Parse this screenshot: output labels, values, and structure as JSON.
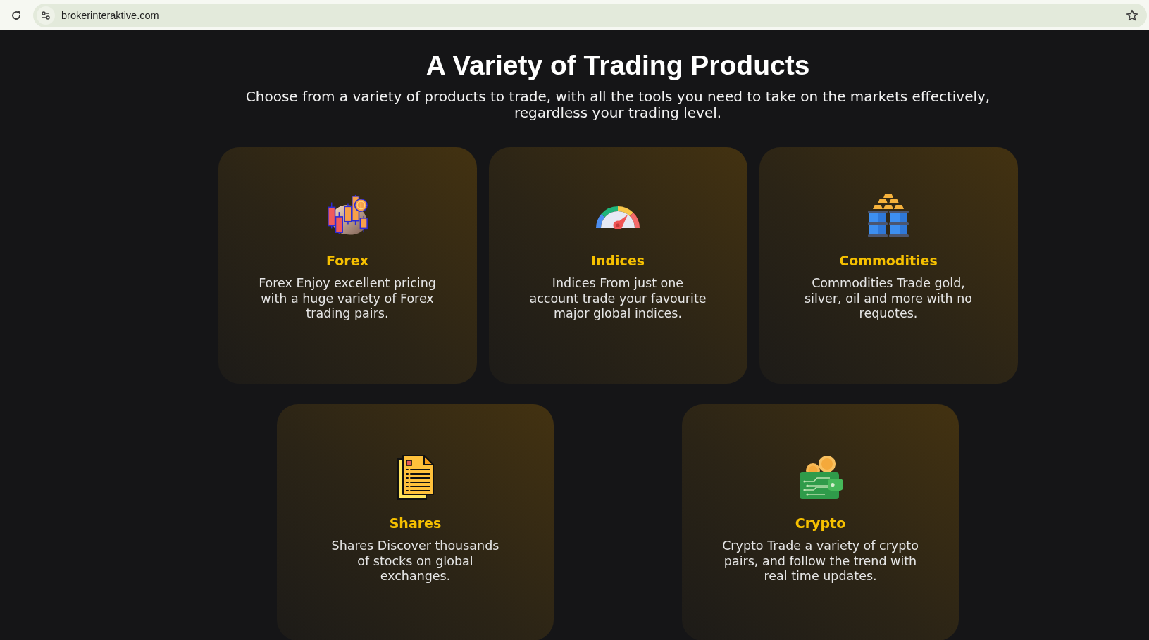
{
  "browser": {
    "url": "brokerinteraktive.com"
  },
  "section": {
    "title": "A Variety of Trading Products",
    "subtitle": "Choose from a variety of products to trade, with all the tools you need to take on the markets effectively, regardless your trading level."
  },
  "product_rows": [
    {
      "cards": [
        {
          "kind": "candlesticks",
          "title": "Forex",
          "description_lines": [
            "Forex Enjoy excellent pricing",
            "with a huge variety of Forex",
            "trading pairs."
          ]
        },
        {
          "kind": "gauge",
          "title": "Indices",
          "description_lines": [
            "Indices From just one",
            "account trade your favourite",
            "major global indices."
          ]
        },
        {
          "kind": "barrels",
          "title": "Commodities",
          "description_lines": [
            "Commodities Trade gold,",
            "silver, oil and more with no",
            "requotes."
          ]
        }
      ]
    },
    {
      "cards": [
        {
          "kind": "document",
          "title": "Shares",
          "description_lines": [
            "Shares Discover thousands",
            "of stocks on global",
            "exchanges."
          ]
        },
        {
          "kind": "wallet",
          "title": "Crypto",
          "description_lines": [
            "Crypto Trade a variety of crypto",
            "pairs, and follow the trend with",
            "real time updates."
          ]
        }
      ]
    }
  ]
}
